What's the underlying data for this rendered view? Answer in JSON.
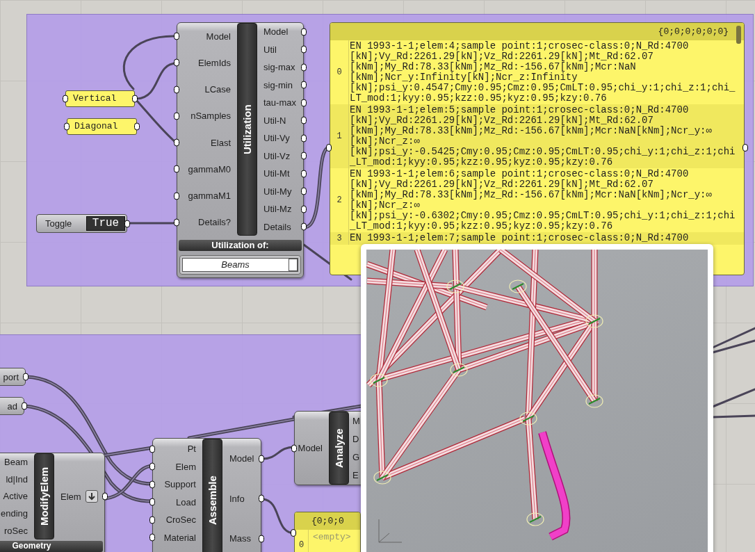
{
  "utilization": {
    "title": "Utilization",
    "inputs": [
      "Model",
      "ElemIds",
      "LCase",
      "nSamples",
      "Elast",
      "gammaM0",
      "gammaM1",
      "Details?"
    ],
    "outputs": [
      "Model",
      "Util",
      "sig-max",
      "sig-min",
      "tau-max",
      "Util-N",
      "Util-Vy",
      "Util-Vz",
      "Util-Mt",
      "Util-My",
      "Util-Mz",
      "Details"
    ],
    "option_title": "Utilization of:",
    "option_value": "Beams"
  },
  "text_panels": [
    {
      "text": "Vertical"
    },
    {
      "text": "Diagonal"
    }
  ],
  "toggle": {
    "label": "Toggle",
    "value": "True"
  },
  "details_panel": {
    "path": "{0;0;0;0;0;0}",
    "rows": [
      {
        "index": "0",
        "text": "EN 1993-1-1;elem:4;sample point:1;crosec-class:0;N_Rd:4700[kN];Vy_Rd:2261.29[kN];Vz_Rd:2261.29[kN];Mt_Rd:62.07[kNm];My_Rd:78.33[kNm];Mz_Rd:-156.67[kNm];Mcr:NaN[kNm];Ncr_y:Infinity[kN];Ncr_z:Infinity[kN];psi_y:0.4547;Cmy:0.95;Cmz:0.95;CmLT:0.95;chi_y:1;chi_z:1;chi_LT_mod:1;kyy:0.95;kzz:0.95;kyz:0.95;kzy:0.76"
      },
      {
        "index": "1",
        "text": "EN 1993-1-1;elem:5;sample point:1;crosec-class:0;N_Rd:4700[kN];Vy_Rd:2261.29[kN];Vz_Rd:2261.29[kN];Mt_Rd:62.07[kNm];My_Rd:78.33[kNm];Mz_Rd:-156.67[kNm];Mcr:NaN[kNm];Ncr_y:∞[kN];Ncr_z:∞[kN];psi_y:-0.5425;Cmy:0.95;Cmz:0.95;CmLT:0.95;chi_y:1;chi_z:1;chi_LT_mod:1;kyy:0.95;kzz:0.95;kyz:0.95;kzy:0.76"
      },
      {
        "index": "2",
        "text": "EN 1993-1-1;elem:6;sample point:1;crosec-class:0;N_Rd:4700[kN];Vy_Rd:2261.29[kN];Vz_Rd:2261.29[kN];Mt_Rd:62.07[kNm];My_Rd:78.33[kNm];Mz_Rd:-156.67[kNm];Mcr:NaN[kNm];Ncr_y:∞[kN];Ncr_z:∞[kN];psi_y:-0.6302;Cmy:0.95;Cmz:0.95;CmLT:0.95;chi_y:1;chi_z:1;chi_LT_mod:1;kyy:0.95;kzz:0.95;kyz:0.95;kzy:0.76"
      },
      {
        "index": "3",
        "text": "EN 1993-1-1;elem:7;sample point:1;crosec-class:0;N_Rd:4700"
      }
    ]
  },
  "param_components": [
    {
      "label": "port"
    },
    {
      "label": "ad"
    }
  ],
  "modify_elem": {
    "title": "ModifyElem",
    "inputs": [
      "Beam",
      "ld|Ind",
      "Active",
      "ending",
      "roSec"
    ],
    "outputs": [
      "Elem"
    ],
    "footer": "Geometry"
  },
  "assemble": {
    "title": "Assemble",
    "inputs": [
      "Pt",
      "Elem",
      "Support",
      "Load",
      "CroSec",
      "Material"
    ],
    "outputs": [
      "Model",
      "Info",
      "Mass"
    ]
  },
  "analyze": {
    "title": "Analyze",
    "inputs": [
      "Model"
    ],
    "outputs": [
      "M",
      "D",
      "G",
      "E"
    ]
  },
  "info_panel": {
    "path": "{0;0;0",
    "rows": [
      {
        "index": "0",
        "text": "<empty>"
      }
    ]
  }
}
